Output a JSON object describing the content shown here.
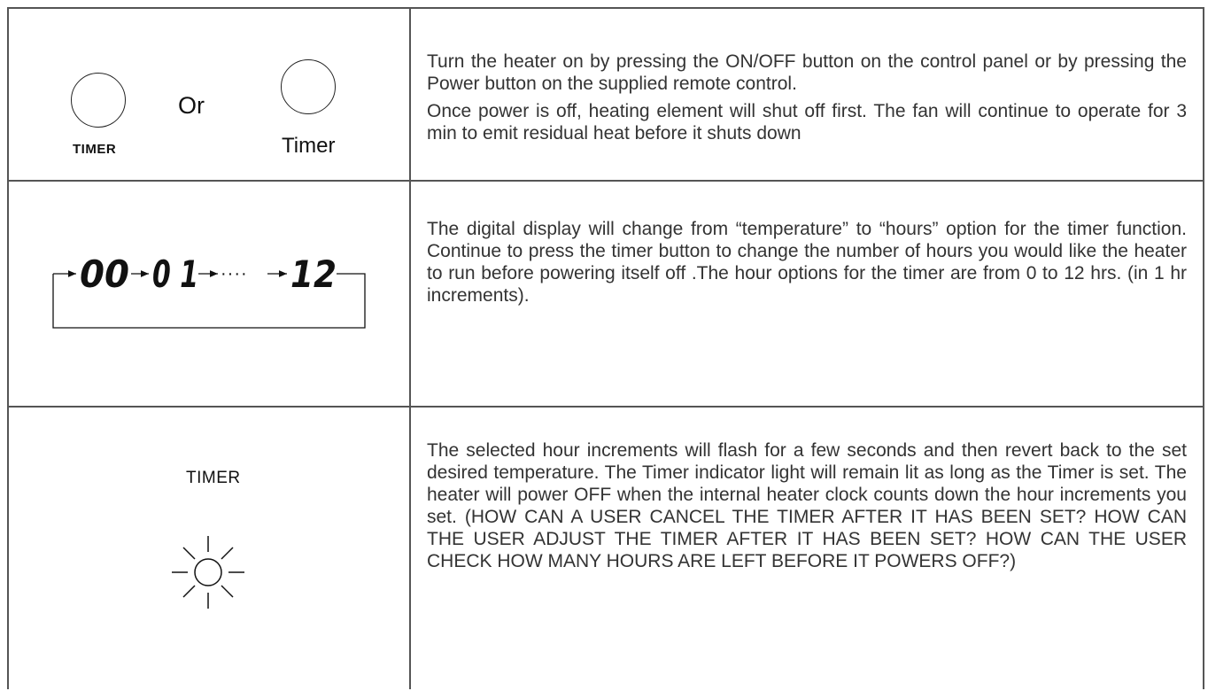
{
  "rows": [
    {
      "icons": {
        "left_button_label": "TIMER",
        "or_text": "Or",
        "right_button_label": "Timer"
      },
      "paragraphs": [
        "Turn the heater on by pressing the ON/OFF button on the control panel or by pressing the Power button on the supplied remote control.",
        "Once power is off, heating element will shut off first.  The fan will continue to operate for 3 min to emit residual heat before it shuts down"
      ]
    },
    {
      "display": {
        "readings": [
          "00",
          "0 1",
          "12"
        ],
        "ellipsis": "····"
      },
      "paragraphs": [
        "The digital display will change from “temperature” to “hours” option for the timer function. Continue to press the timer button to change the number of  hours you would like the heater to run before powering itself  off .The hour options for the timer are from 0 to 12 hrs. (in 1 hr increments)."
      ]
    },
    {
      "indicator": {
        "label": "TIMER",
        "icon": "indicator-light-icon"
      },
      "paragraphs": [
        "The selected hour increments will flash for a few seconds and then revert back to the set desired temperature. The Timer indicator light will remain lit as long as the Timer is set. The heater will power OFF when the internal heater clock counts down the hour increments you set. (HOW CAN A USER CANCEL THE TIMER AFTER IT HAS BEEN SET? HOW CAN THE USER ADJUST THE TIMER AFTER IT HAS BEEN SET? HOW CAN THE USER CHECK HOW MANY HOURS ARE LEFT BEFORE IT POWERS OFF?)"
      ]
    }
  ]
}
